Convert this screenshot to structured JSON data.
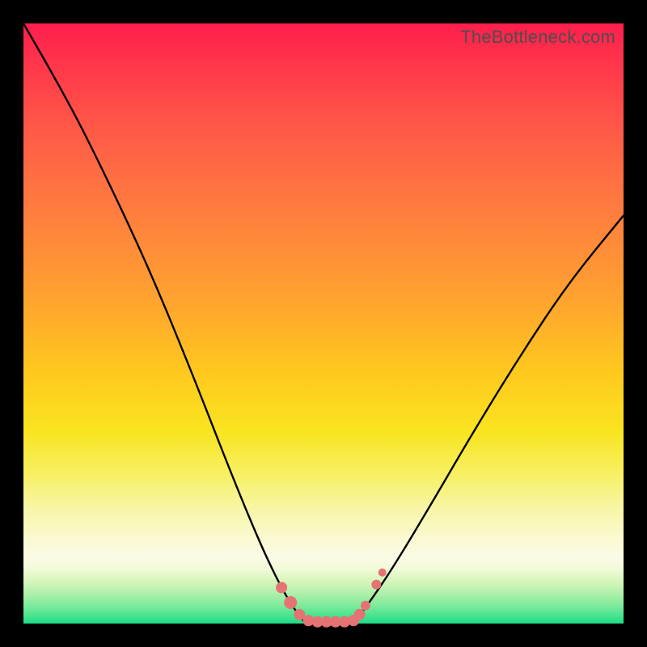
{
  "watermark": "TheBottleneck.com",
  "chart_data": {
    "type": "line",
    "title": "",
    "xlabel": "",
    "ylabel": "",
    "ylim": [
      0,
      100
    ],
    "xlim": [
      0,
      100
    ],
    "series": [
      {
        "name": "curve-left",
        "x": [
          0,
          7,
          14,
          21,
          28,
          35,
          40,
          44,
          47
        ],
        "y": [
          100,
          88,
          74,
          59,
          42,
          24,
          12,
          4,
          0
        ]
      },
      {
        "name": "curve-floor",
        "x": [
          47,
          50,
          53,
          55
        ],
        "y": [
          0,
          0,
          0,
          0
        ]
      },
      {
        "name": "curve-right",
        "x": [
          55,
          58,
          62,
          68,
          75,
          83,
          91,
          100
        ],
        "y": [
          0,
          4,
          10,
          20,
          32,
          45,
          57,
          68
        ]
      }
    ],
    "markers": [
      {
        "x": 43.0,
        "y": 6.0,
        "r": 7
      },
      {
        "x": 44.5,
        "y": 3.5,
        "r": 8
      },
      {
        "x": 46.0,
        "y": 1.5,
        "r": 7
      },
      {
        "x": 47.5,
        "y": 0.5,
        "r": 7
      },
      {
        "x": 49.0,
        "y": 0.3,
        "r": 7
      },
      {
        "x": 50.5,
        "y": 0.3,
        "r": 7
      },
      {
        "x": 52.0,
        "y": 0.3,
        "r": 7
      },
      {
        "x": 53.5,
        "y": 0.3,
        "r": 7
      },
      {
        "x": 55.0,
        "y": 0.5,
        "r": 7
      },
      {
        "x": 56.0,
        "y": 1.5,
        "r": 7
      },
      {
        "x": 57.0,
        "y": 3.0,
        "r": 6
      },
      {
        "x": 58.8,
        "y": 6.5,
        "r": 6
      },
      {
        "x": 59.8,
        "y": 8.5,
        "r": 5
      }
    ],
    "marker_color": "#e57373",
    "curve_color": "#000000",
    "background": "gradient"
  }
}
